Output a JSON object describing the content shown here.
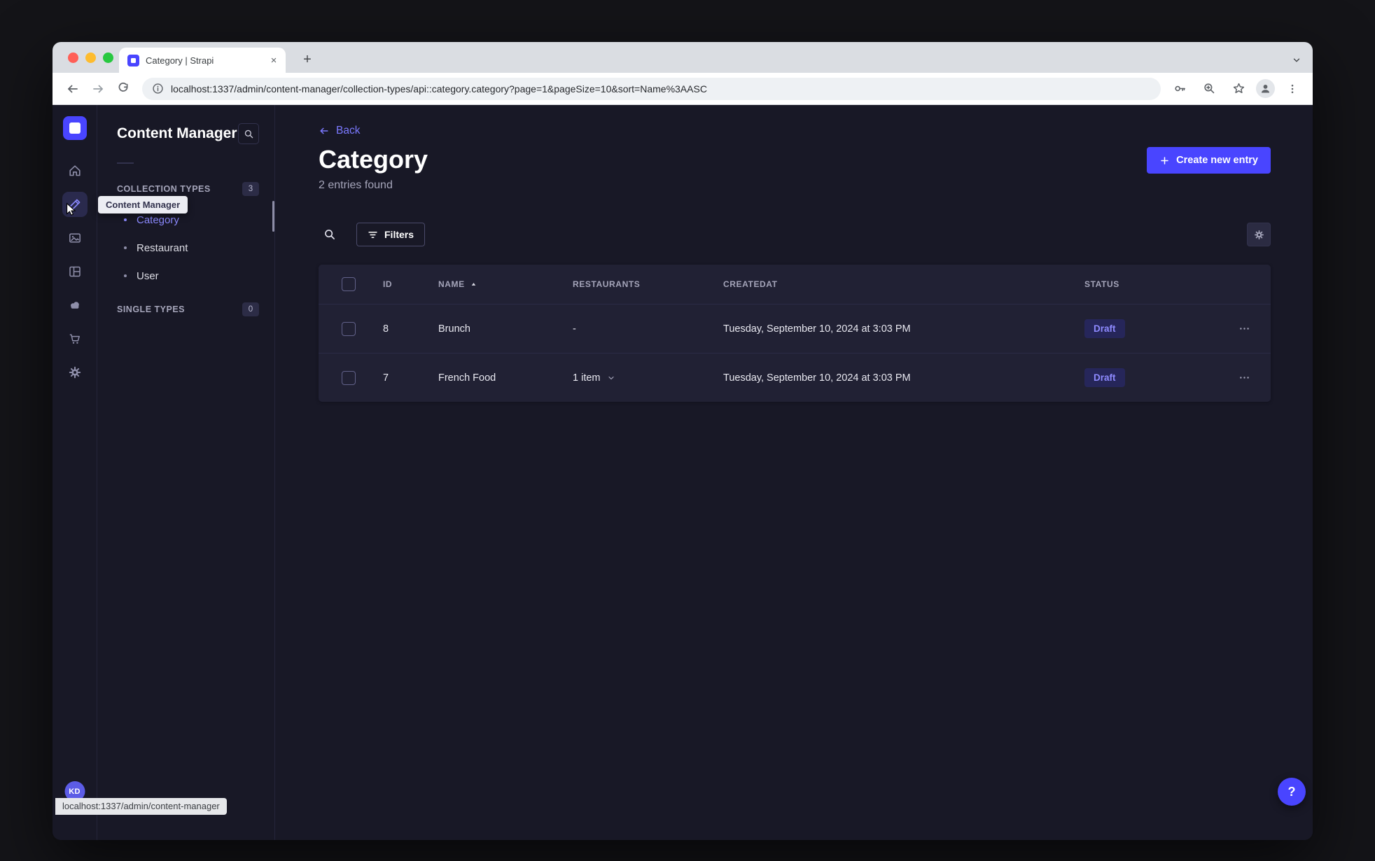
{
  "window": {
    "tab_title": "Category | Strapi",
    "url": "localhost:1337/admin/content-manager/collection-types/api::category.category?page=1&pageSize=10&sort=Name%3AASC",
    "status_tooltip": "localhost:1337/admin/content-manager"
  },
  "nav_rail": {
    "tooltip": "Content Manager",
    "avatar_initials": "KD"
  },
  "sidebar": {
    "title": "Content Manager",
    "collection_section": {
      "label": "COLLECTION TYPES",
      "badge": "3"
    },
    "items": [
      {
        "label": "Category",
        "active": true
      },
      {
        "label": "Restaurant",
        "active": false
      },
      {
        "label": "User",
        "active": false
      }
    ],
    "single_section": {
      "label": "SINGLE TYPES",
      "badge": "0"
    }
  },
  "main": {
    "back_label": "Back",
    "title": "Category",
    "subtitle": "2 entries found",
    "create_button_label": "Create new entry",
    "filters_button_label": "Filters"
  },
  "table": {
    "headers": {
      "id": "ID",
      "name": "NAME",
      "restaurants": "RESTAURANTS",
      "createdat": "CREATEDAT",
      "status": "STATUS"
    },
    "rows": [
      {
        "id": "8",
        "name": "Brunch",
        "restaurants": "-",
        "createdat": "Tuesday, September 10, 2024 at 3:03 PM",
        "status": "Draft"
      },
      {
        "id": "7",
        "name": "French Food",
        "restaurants": "1 item",
        "createdat": "Tuesday, September 10, 2024 at 3:03 PM",
        "status": "Draft"
      }
    ]
  },
  "help": {
    "label": "?"
  },
  "icons": {
    "nav_rail": [
      "home",
      "content-manager",
      "media-library",
      "content-type-builder",
      "cloud",
      "marketplace",
      "settings"
    ],
    "browser": [
      "back",
      "forward",
      "reload",
      "page-info",
      "passwords-key",
      "zoom",
      "bookmark-star",
      "profile",
      "menu-kebab",
      "new-tab",
      "tab-search",
      "close-tab"
    ]
  },
  "colors": {
    "accent": "#4945ff",
    "accent_light": "#7b79ff",
    "page_bg": "#181826",
    "card_bg": "#212134",
    "traffic_lights": [
      "#ff5f57",
      "#febc2e",
      "#28c840"
    ]
  }
}
